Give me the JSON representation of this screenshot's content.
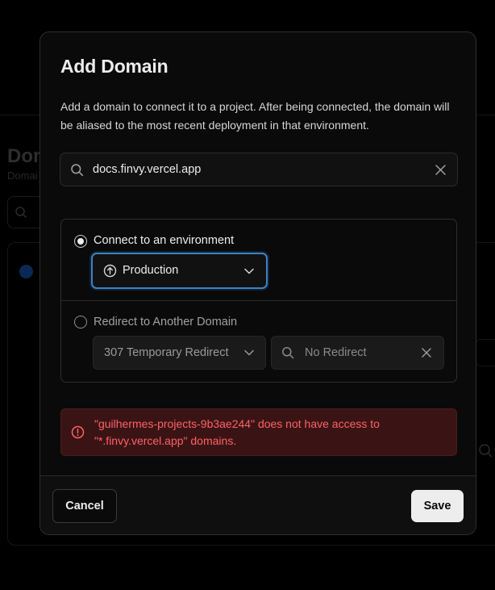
{
  "background": {
    "title": "Dom",
    "subtitle": "Domai"
  },
  "modal": {
    "title": "Add Domain",
    "description": "Add a domain to connect it to a project. After being connected, the domain will be aliased to the most recent deployment in that environment.",
    "domain_input": {
      "value": "docs.finvy.vercel.app",
      "icon": "search-icon",
      "clear_icon": "close-icon"
    },
    "options": {
      "connect": {
        "label": "Connect to an environment",
        "selected": true,
        "environment": "Production",
        "environment_icon": "arrow-up-circle-icon"
      },
      "redirect": {
        "label": "Redirect to Another Domain",
        "selected": false,
        "redirect_type": "307 Temporary Redirect",
        "target_placeholder": "No Redirect"
      }
    },
    "error": {
      "message": "\"guilhermes-projects-9b3ae244\" does not have access to \"*.finvy.vercel.app\" domains.",
      "icon": "alert-circle-icon",
      "color": "#ff6166"
    },
    "footer": {
      "cancel_label": "Cancel",
      "save_label": "Save"
    }
  },
  "colors": {
    "accent_focus": "#3b82c6",
    "error_bg": "#3a1414",
    "modal_bg": "#0a0a0a"
  }
}
